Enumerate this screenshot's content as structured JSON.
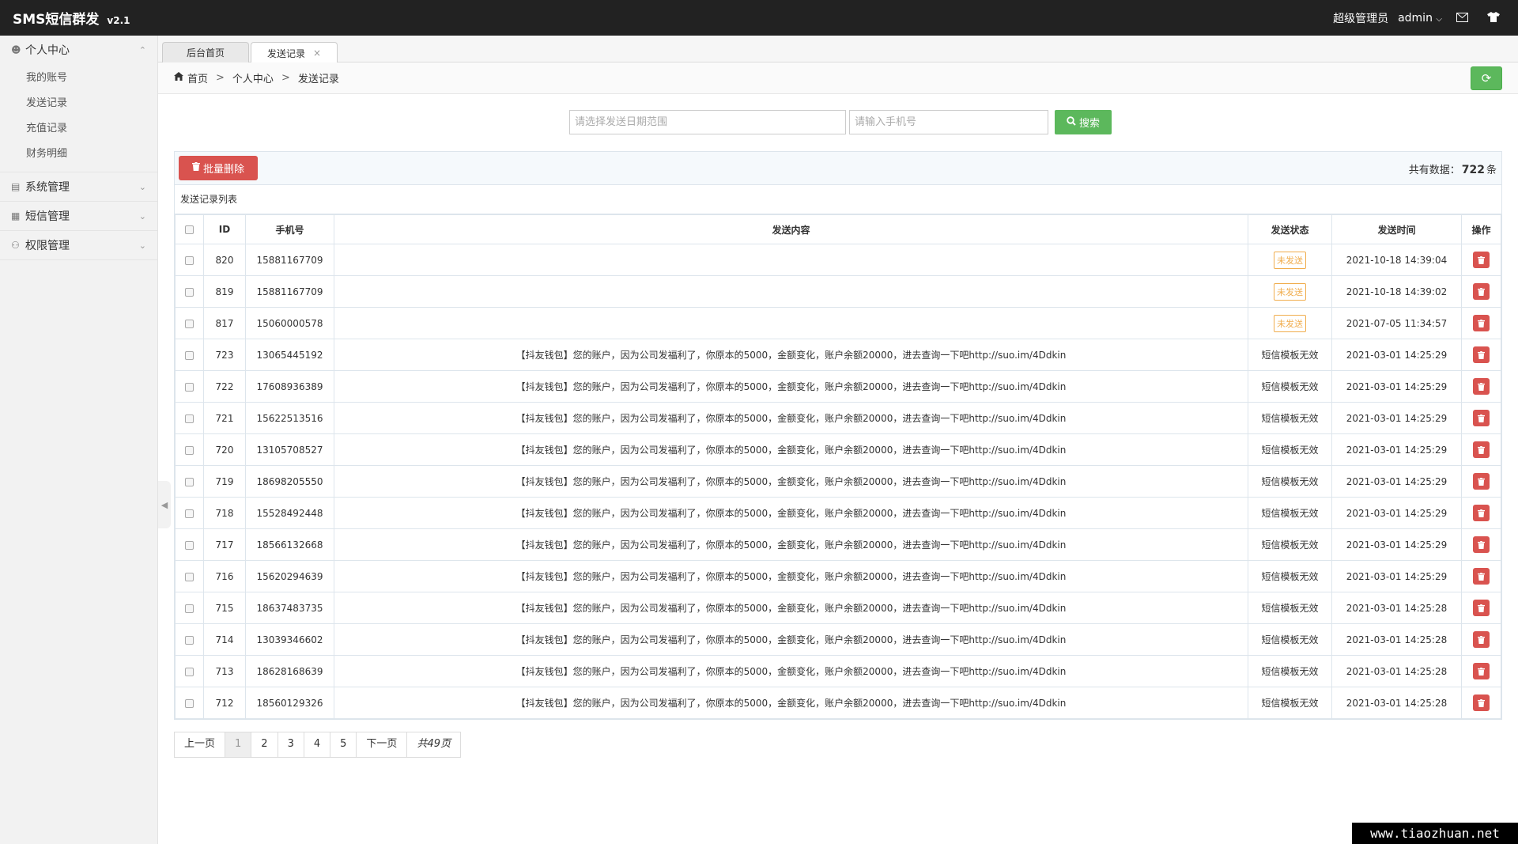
{
  "app": {
    "title": "SMS短信群发",
    "version": "v2.1"
  },
  "topbar": {
    "role": "超级管理员",
    "user": "admin",
    "icons": [
      "chevron-down-icon",
      "mail-icon",
      "shirt-icon"
    ]
  },
  "sidebar": {
    "groups": [
      {
        "label": "个人中心",
        "icon": "user-icon",
        "expanded": true,
        "items": [
          "我的账号",
          "发送记录",
          "充值记录",
          "财务明细"
        ]
      },
      {
        "label": "系统管理",
        "icon": "database-icon",
        "expanded": false,
        "items": []
      },
      {
        "label": "短信管理",
        "icon": "table-icon",
        "expanded": false,
        "items": []
      },
      {
        "label": "权限管理",
        "icon": "users-icon",
        "expanded": false,
        "items": []
      }
    ]
  },
  "tabs": [
    {
      "label": "后台首页",
      "active": false
    },
    {
      "label": "发送记录",
      "active": true,
      "close": "×"
    }
  ],
  "breadcrumb": {
    "home": "首页",
    "items": [
      "个人中心",
      "发送记录"
    ],
    "sep": ">"
  },
  "search": {
    "date_placeholder": "请选择发送日期范围",
    "phone_placeholder": "请输入手机号",
    "button": "搜索"
  },
  "toolbar": {
    "batch_delete": "批量删除",
    "total_prefix": "共有数据：",
    "total_count": "722",
    "total_suffix": "条"
  },
  "list": {
    "caption": "发送记录列表",
    "columns": [
      "ID",
      "手机号",
      "发送内容",
      "发送状态",
      "发送时间",
      "操作"
    ],
    "rows": [
      {
        "id": "820",
        "phone": "15881167709",
        "content": "",
        "status": "未发送",
        "status_type": "badge",
        "time": "2021-10-18 14:39:04"
      },
      {
        "id": "819",
        "phone": "15881167709",
        "content": "",
        "status": "未发送",
        "status_type": "badge",
        "time": "2021-10-18 14:39:02"
      },
      {
        "id": "817",
        "phone": "15060000578",
        "content": "",
        "status": "未发送",
        "status_type": "badge",
        "time": "2021-07-05 11:34:57"
      },
      {
        "id": "723",
        "phone": "13065445192",
        "content": "【抖友钱包】您的账户，因为公司发福利了，你原本的5000，金额变化，账户余额20000，进去查询一下吧http://suo.im/4Ddkin",
        "status": "短信模板无效",
        "status_type": "text",
        "time": "2021-03-01 14:25:29"
      },
      {
        "id": "722",
        "phone": "17608936389",
        "content": "【抖友钱包】您的账户，因为公司发福利了，你原本的5000，金额变化，账户余额20000，进去查询一下吧http://suo.im/4Ddkin",
        "status": "短信模板无效",
        "status_type": "text",
        "time": "2021-03-01 14:25:29"
      },
      {
        "id": "721",
        "phone": "15622513516",
        "content": "【抖友钱包】您的账户，因为公司发福利了，你原本的5000，金额变化，账户余额20000，进去查询一下吧http://suo.im/4Ddkin",
        "status": "短信模板无效",
        "status_type": "text",
        "time": "2021-03-01 14:25:29"
      },
      {
        "id": "720",
        "phone": "13105708527",
        "content": "【抖友钱包】您的账户，因为公司发福利了，你原本的5000，金额变化，账户余额20000，进去查询一下吧http://suo.im/4Ddkin",
        "status": "短信模板无效",
        "status_type": "text",
        "time": "2021-03-01 14:25:29"
      },
      {
        "id": "719",
        "phone": "18698205550",
        "content": "【抖友钱包】您的账户，因为公司发福利了，你原本的5000，金额变化，账户余额20000，进去查询一下吧http://suo.im/4Ddkin",
        "status": "短信模板无效",
        "status_type": "text",
        "time": "2021-03-01 14:25:29"
      },
      {
        "id": "718",
        "phone": "15528492448",
        "content": "【抖友钱包】您的账户，因为公司发福利了，你原本的5000，金额变化，账户余额20000，进去查询一下吧http://suo.im/4Ddkin",
        "status": "短信模板无效",
        "status_type": "text",
        "time": "2021-03-01 14:25:29"
      },
      {
        "id": "717",
        "phone": "18566132668",
        "content": "【抖友钱包】您的账户，因为公司发福利了，你原本的5000，金额变化，账户余额20000，进去查询一下吧http://suo.im/4Ddkin",
        "status": "短信模板无效",
        "status_type": "text",
        "time": "2021-03-01 14:25:29"
      },
      {
        "id": "716",
        "phone": "15620294639",
        "content": "【抖友钱包】您的账户，因为公司发福利了，你原本的5000，金额变化，账户余额20000，进去查询一下吧http://suo.im/4Ddkin",
        "status": "短信模板无效",
        "status_type": "text",
        "time": "2021-03-01 14:25:29"
      },
      {
        "id": "715",
        "phone": "18637483735",
        "content": "【抖友钱包】您的账户，因为公司发福利了，你原本的5000，金额变化，账户余额20000，进去查询一下吧http://suo.im/4Ddkin",
        "status": "短信模板无效",
        "status_type": "text",
        "time": "2021-03-01 14:25:28"
      },
      {
        "id": "714",
        "phone": "13039346602",
        "content": "【抖友钱包】您的账户，因为公司发福利了，你原本的5000，金额变化，账户余额20000，进去查询一下吧http://suo.im/4Ddkin",
        "status": "短信模板无效",
        "status_type": "text",
        "time": "2021-03-01 14:25:28"
      },
      {
        "id": "713",
        "phone": "18628168639",
        "content": "【抖友钱包】您的账户，因为公司发福利了，你原本的5000，金额变化，账户余额20000，进去查询一下吧http://suo.im/4Ddkin",
        "status": "短信模板无效",
        "status_type": "text",
        "time": "2021-03-01 14:25:28"
      },
      {
        "id": "712",
        "phone": "18560129326",
        "content": "【抖友钱包】您的账户，因为公司发福利了，你原本的5000，金额变化，账户余额20000，进去查询一下吧http://suo.im/4Ddkin",
        "status": "短信模板无效",
        "status_type": "text",
        "time": "2021-03-01 14:25:28"
      }
    ]
  },
  "pagination": {
    "prev": "上一页",
    "pages": [
      "1",
      "2",
      "3",
      "4",
      "5"
    ],
    "current": "1",
    "next": "下一页",
    "total": "共49页"
  },
  "watermark": "www.tiaozhuan.net",
  "colors": {
    "topbar": "#222222",
    "success": "#5cb85c",
    "danger": "#d9534f",
    "warning": "#f0ad4e"
  }
}
